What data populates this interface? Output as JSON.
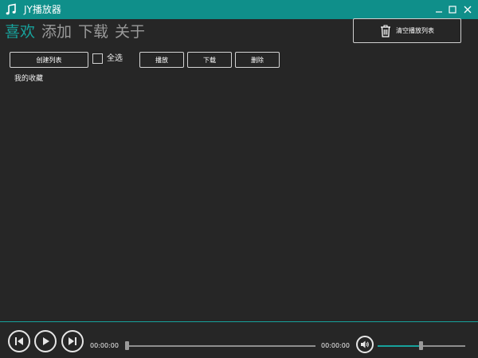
{
  "window": {
    "title": "JY播放器",
    "app_icon": "music-note-icon",
    "title_bar_color": "#0f8f8a",
    "accent_color": "#17a29c",
    "controls": [
      "minimize-icon",
      "maximize-icon",
      "close-icon"
    ]
  },
  "nav": {
    "tabs": [
      {
        "label": "喜欢",
        "active": true
      },
      {
        "label": "添加",
        "active": false
      },
      {
        "label": "下载",
        "active": false
      },
      {
        "label": "关于",
        "active": false
      }
    ]
  },
  "toolbar": {
    "clear_playlist_label": "清空播放列表",
    "clear_icon": "trash-icon",
    "create_list_label": "创建列表",
    "select_all_label": "全选",
    "select_all_checked": false,
    "play_label": "播放",
    "download_label": "下载",
    "delete_label": "删除"
  },
  "lists": {
    "items": [
      "我的收藏"
    ]
  },
  "player": {
    "current_time": "00:00:00",
    "total_time": "00:00:00",
    "progress": 0,
    "volume": 0.5,
    "prev_icon": "previous-track-icon",
    "play_icon": "play-icon",
    "next_icon": "next-track-icon",
    "volume_icon": "volume-icon"
  }
}
